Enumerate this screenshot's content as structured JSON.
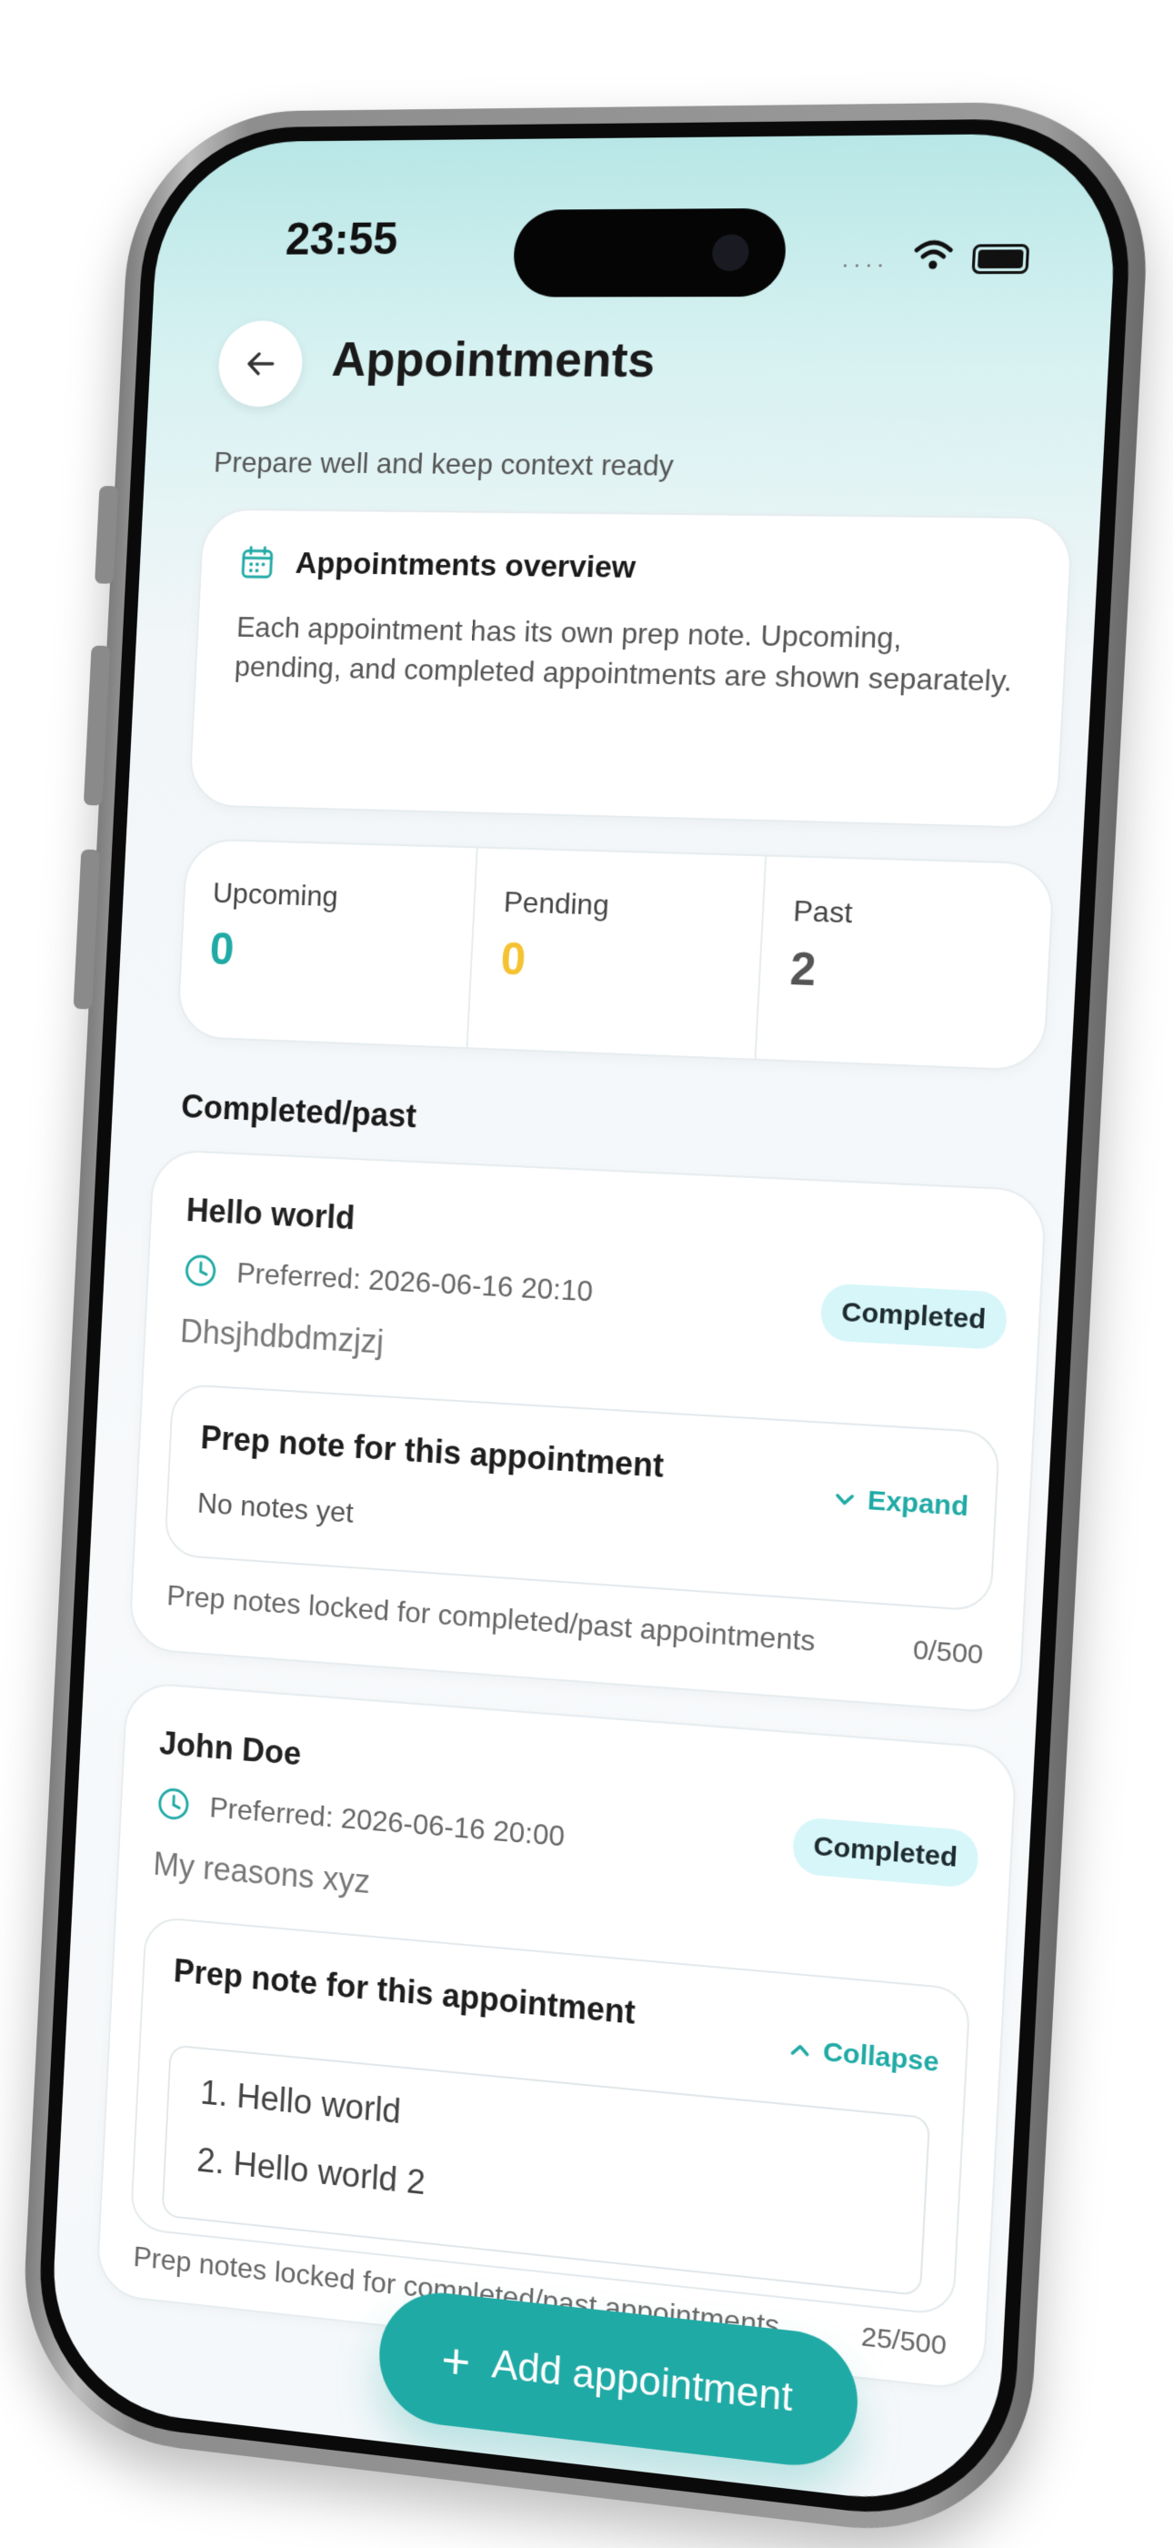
{
  "status_bar": {
    "time": "23:55",
    "signal": "····"
  },
  "header": {
    "title": "Appointments",
    "subtitle": "Prepare well and keep context ready"
  },
  "overview": {
    "title": "Appointments overview",
    "body": "Each appointment has its own prep note. Upcoming, pending, and completed appointments are shown separately."
  },
  "stats": [
    {
      "label": "Upcoming",
      "value": "0",
      "color": "#20aaa5"
    },
    {
      "label": "Pending",
      "value": "0",
      "color": "#f5c232"
    },
    {
      "label": "Past",
      "value": "2",
      "color": "#555555"
    }
  ],
  "section_title": "Completed/past",
  "appointments": [
    {
      "title": "Hello world",
      "preferred": "Preferred: 2026-06-16 20:10",
      "status": "Completed",
      "reason": "Dhsjhdbdmzjzj",
      "prep_title": "Prep note for this appointment",
      "toggle_label": "Expand",
      "empty_text": "No notes yet",
      "locked_text": "Prep notes locked for completed/past appointments",
      "count": "0/500"
    },
    {
      "title": "John Doe",
      "preferred": "Preferred: 2026-06-16 20:00",
      "status": "Completed",
      "reason": "My reasons xyz",
      "prep_title": "Prep note for this appointment",
      "toggle_label": "Collapse",
      "notes": [
        "1. Hello world",
        "2. Hello world 2"
      ],
      "locked_text": "Prep notes locked for completed/past appointments",
      "count": "25/500"
    }
  ],
  "fab": {
    "label": "Add appointment"
  },
  "colors": {
    "accent": "#20aaa5",
    "badge_bg": "#d7f6fa",
    "pending": "#f5c232"
  }
}
